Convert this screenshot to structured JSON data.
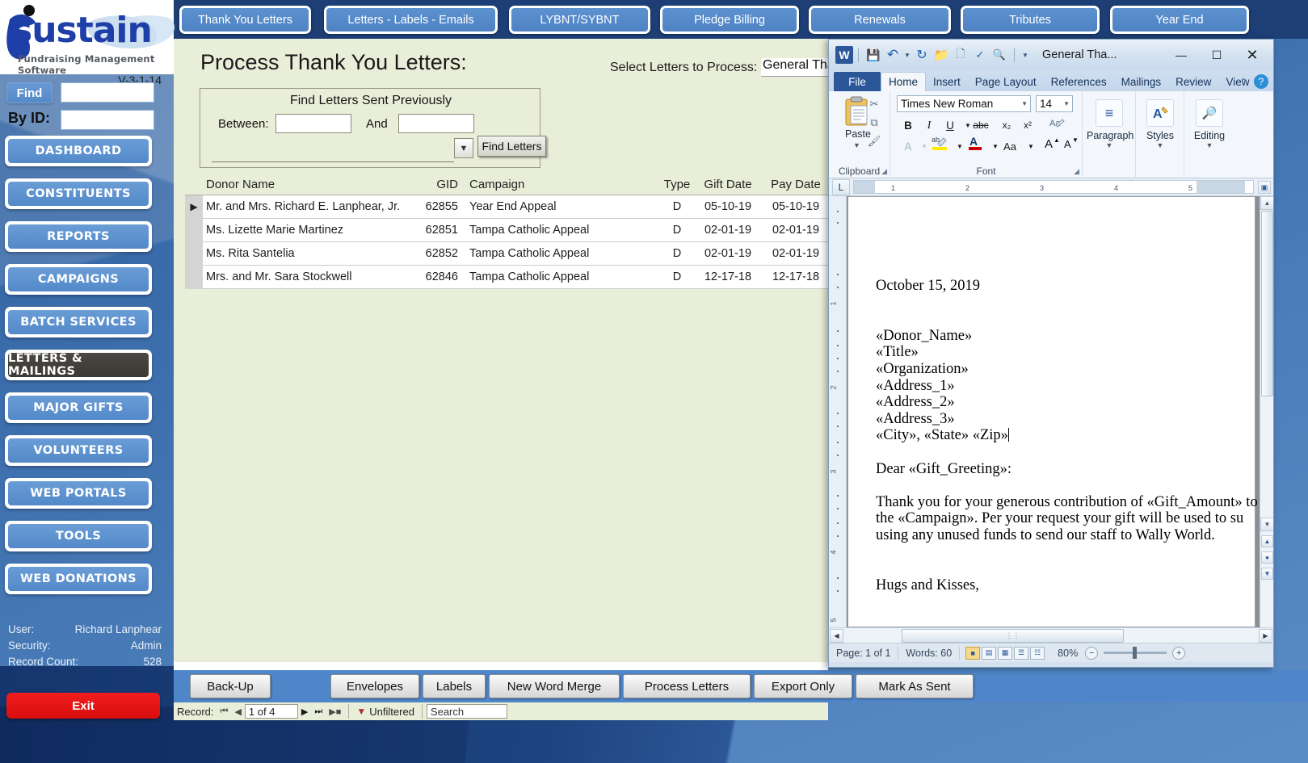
{
  "sidebar": {
    "logo_text": "sustain",
    "logo_tagline": "Fundraising Management Software",
    "version": "V-3-1-14",
    "find_button": "Find",
    "find_value": "",
    "by_id_label": "By ID:",
    "by_id_value": "",
    "nav_items": [
      {
        "label": "DASHBOARD",
        "active": false
      },
      {
        "label": "CONSTITUENTS",
        "active": false
      },
      {
        "label": "REPORTS",
        "active": false
      },
      {
        "label": "CAMPAIGNS",
        "active": false
      },
      {
        "label": "BATCH SERVICES",
        "active": false
      },
      {
        "label": "LETTERS & MAILINGS",
        "active": true
      },
      {
        "label": "MAJOR GIFTS",
        "active": false
      },
      {
        "label": "VOLUNTEERS",
        "active": false
      },
      {
        "label": "WEB PORTALS",
        "active": false
      },
      {
        "label": "TOOLS",
        "active": false
      },
      {
        "label": "WEB DONATIONS",
        "active": false
      }
    ],
    "status": {
      "user_label": "User:",
      "user_value": "Richard Lanphear",
      "security_label": "Security:",
      "security_value": "Admin",
      "record_count_label": "Record Count:",
      "record_count_value": "528"
    },
    "exit_button": "Exit"
  },
  "tabs": [
    {
      "label": "Thank You Letters"
    },
    {
      "label": "Letters - Labels - Emails"
    },
    {
      "label": "LYBNT/SYBNT"
    },
    {
      "label": "Pledge Billing"
    },
    {
      "label": "Renewals"
    },
    {
      "label": "Tributes"
    },
    {
      "label": "Year End"
    }
  ],
  "form": {
    "title": "Process Thank You Letters:",
    "select_letters_label": "Select Letters to Process:",
    "select_letters_value": "General Tha",
    "find_prev": {
      "title": "Find Letters Sent Previously",
      "between_label": "Between:",
      "between_value": "",
      "and_label": "And",
      "and_value": "",
      "combo_value": "",
      "find_letters_button": "Find Letters"
    },
    "table": {
      "columns": [
        "Donor Name",
        "GID",
        "Campaign",
        "Type",
        "Gift Date",
        "Pay Date"
      ],
      "rows": [
        {
          "selected": true,
          "name": "Mr. and Mrs. Richard E. Lanphear, Jr.",
          "gid": "62855",
          "campaign": "Year End Appeal",
          "type": "D",
          "gift_date": "05-10-19",
          "pay_date": "05-10-19"
        },
        {
          "selected": false,
          "name": "Ms. Lizette Marie Martinez",
          "gid": "62851",
          "campaign": "Tampa Catholic Appeal",
          "type": "D",
          "gift_date": "02-01-19",
          "pay_date": "02-01-19"
        },
        {
          "selected": false,
          "name": "Ms. Rita Santelia",
          "gid": "62852",
          "campaign": "Tampa Catholic Appeal",
          "type": "D",
          "gift_date": "02-01-19",
          "pay_date": "02-01-19"
        },
        {
          "selected": false,
          "name": "Mrs. and Mr. Sara Stockwell",
          "gid": "62846",
          "campaign": "Tampa Catholic Appeal",
          "type": "D",
          "gift_date": "12-17-18",
          "pay_date": "12-17-18"
        }
      ]
    }
  },
  "action_bar": [
    {
      "label": "Back-Up"
    },
    {
      "label": "Envelopes"
    },
    {
      "label": "Labels"
    },
    {
      "label": "New Word Merge"
    },
    {
      "label": "Process Letters"
    },
    {
      "label": "Export Only"
    },
    {
      "label": "Mark As Sent"
    }
  ],
  "record_bar": {
    "record_label": "Record:",
    "position": "1 of 4",
    "filter_label": "Unfiltered",
    "search_placeholder": "Search",
    "search_value": ""
  },
  "word": {
    "title": "General Tha...",
    "qat": [
      {
        "name": "save-icon",
        "glyph": "💾"
      },
      {
        "name": "undo-icon",
        "glyph": "↶"
      },
      {
        "name": "undo-dropdown-icon",
        "glyph": "▾"
      },
      {
        "name": "redo-icon",
        "glyph": "↻"
      },
      {
        "name": "open-icon",
        "glyph": "📂"
      },
      {
        "name": "new-document-icon",
        "glyph": "🗋"
      },
      {
        "name": "spelling-icon",
        "glyph": "✓"
      },
      {
        "name": "print-preview-icon",
        "glyph": "🔍"
      },
      {
        "name": "customize-qat-icon",
        "glyph": "▾"
      }
    ],
    "window_buttons": {
      "minimize": "—",
      "maximize": "☐",
      "close": "✕"
    },
    "ribbon_tabs": [
      {
        "label": "File",
        "type": "file"
      },
      {
        "label": "Home",
        "active": true
      },
      {
        "label": "Insert",
        "active": false
      },
      {
        "label": "Page Layout",
        "active": false
      },
      {
        "label": "References",
        "active": false
      },
      {
        "label": "Mailings",
        "active": false
      },
      {
        "label": "Review",
        "active": false
      },
      {
        "label": "View",
        "active": false
      }
    ],
    "ribbon_help": "?",
    "ribbon_collapse": "⌃",
    "groups": {
      "clipboard": {
        "label": "Clipboard",
        "paste_label": "Paste",
        "cut_icon": "✂",
        "copy_icon": "⧉",
        "format_painter_icon": "🖌"
      },
      "font": {
        "label": "Font",
        "font_name": "Times New Roman",
        "font_size": "14",
        "bold": "B",
        "italic": "I",
        "underline": "U",
        "strikethrough": "abc",
        "subscript": "x₂",
        "superscript": "x²",
        "clear_formatting": "A",
        "text_effects": "A",
        "highlight": "ab",
        "font_color": "A",
        "change_case": "Aa",
        "grow_font": "A▴",
        "shrink_font": "A▾"
      },
      "paragraph": {
        "label": "Paragraph",
        "icon": "≡"
      },
      "styles": {
        "label": "Styles",
        "icon": "A"
      },
      "editing": {
        "label": "Editing",
        "icon": "🔎"
      }
    },
    "ruler": {
      "tab_stop": "L",
      "ticks": [
        "1",
        "2",
        "3",
        "4",
        "5"
      ],
      "v_ticks": [
        "1",
        "2",
        "3",
        "4",
        "5"
      ]
    },
    "document_lines": [
      "",
      "",
      "October 15, 2019",
      "",
      "",
      "«Donor_Name»",
      "«Title»",
      "«Organization»",
      "«Address_1»",
      "«Address_2»",
      "«Address_3»",
      "«City», «State»  «Zip»",
      "",
      "Dear «Gift_Greeting»:",
      "",
      "Thank you for your generous contribution of «Gift_Amount» to",
      "the «Campaign».  Per your request your gift will be used to su",
      "using any unused funds to send our staff to Wally World.",
      "",
      "",
      "Hugs and Kisses,"
    ],
    "status_bar": {
      "page": "Page: 1 of 1",
      "words": "Words: 60",
      "zoom": "80%"
    }
  }
}
